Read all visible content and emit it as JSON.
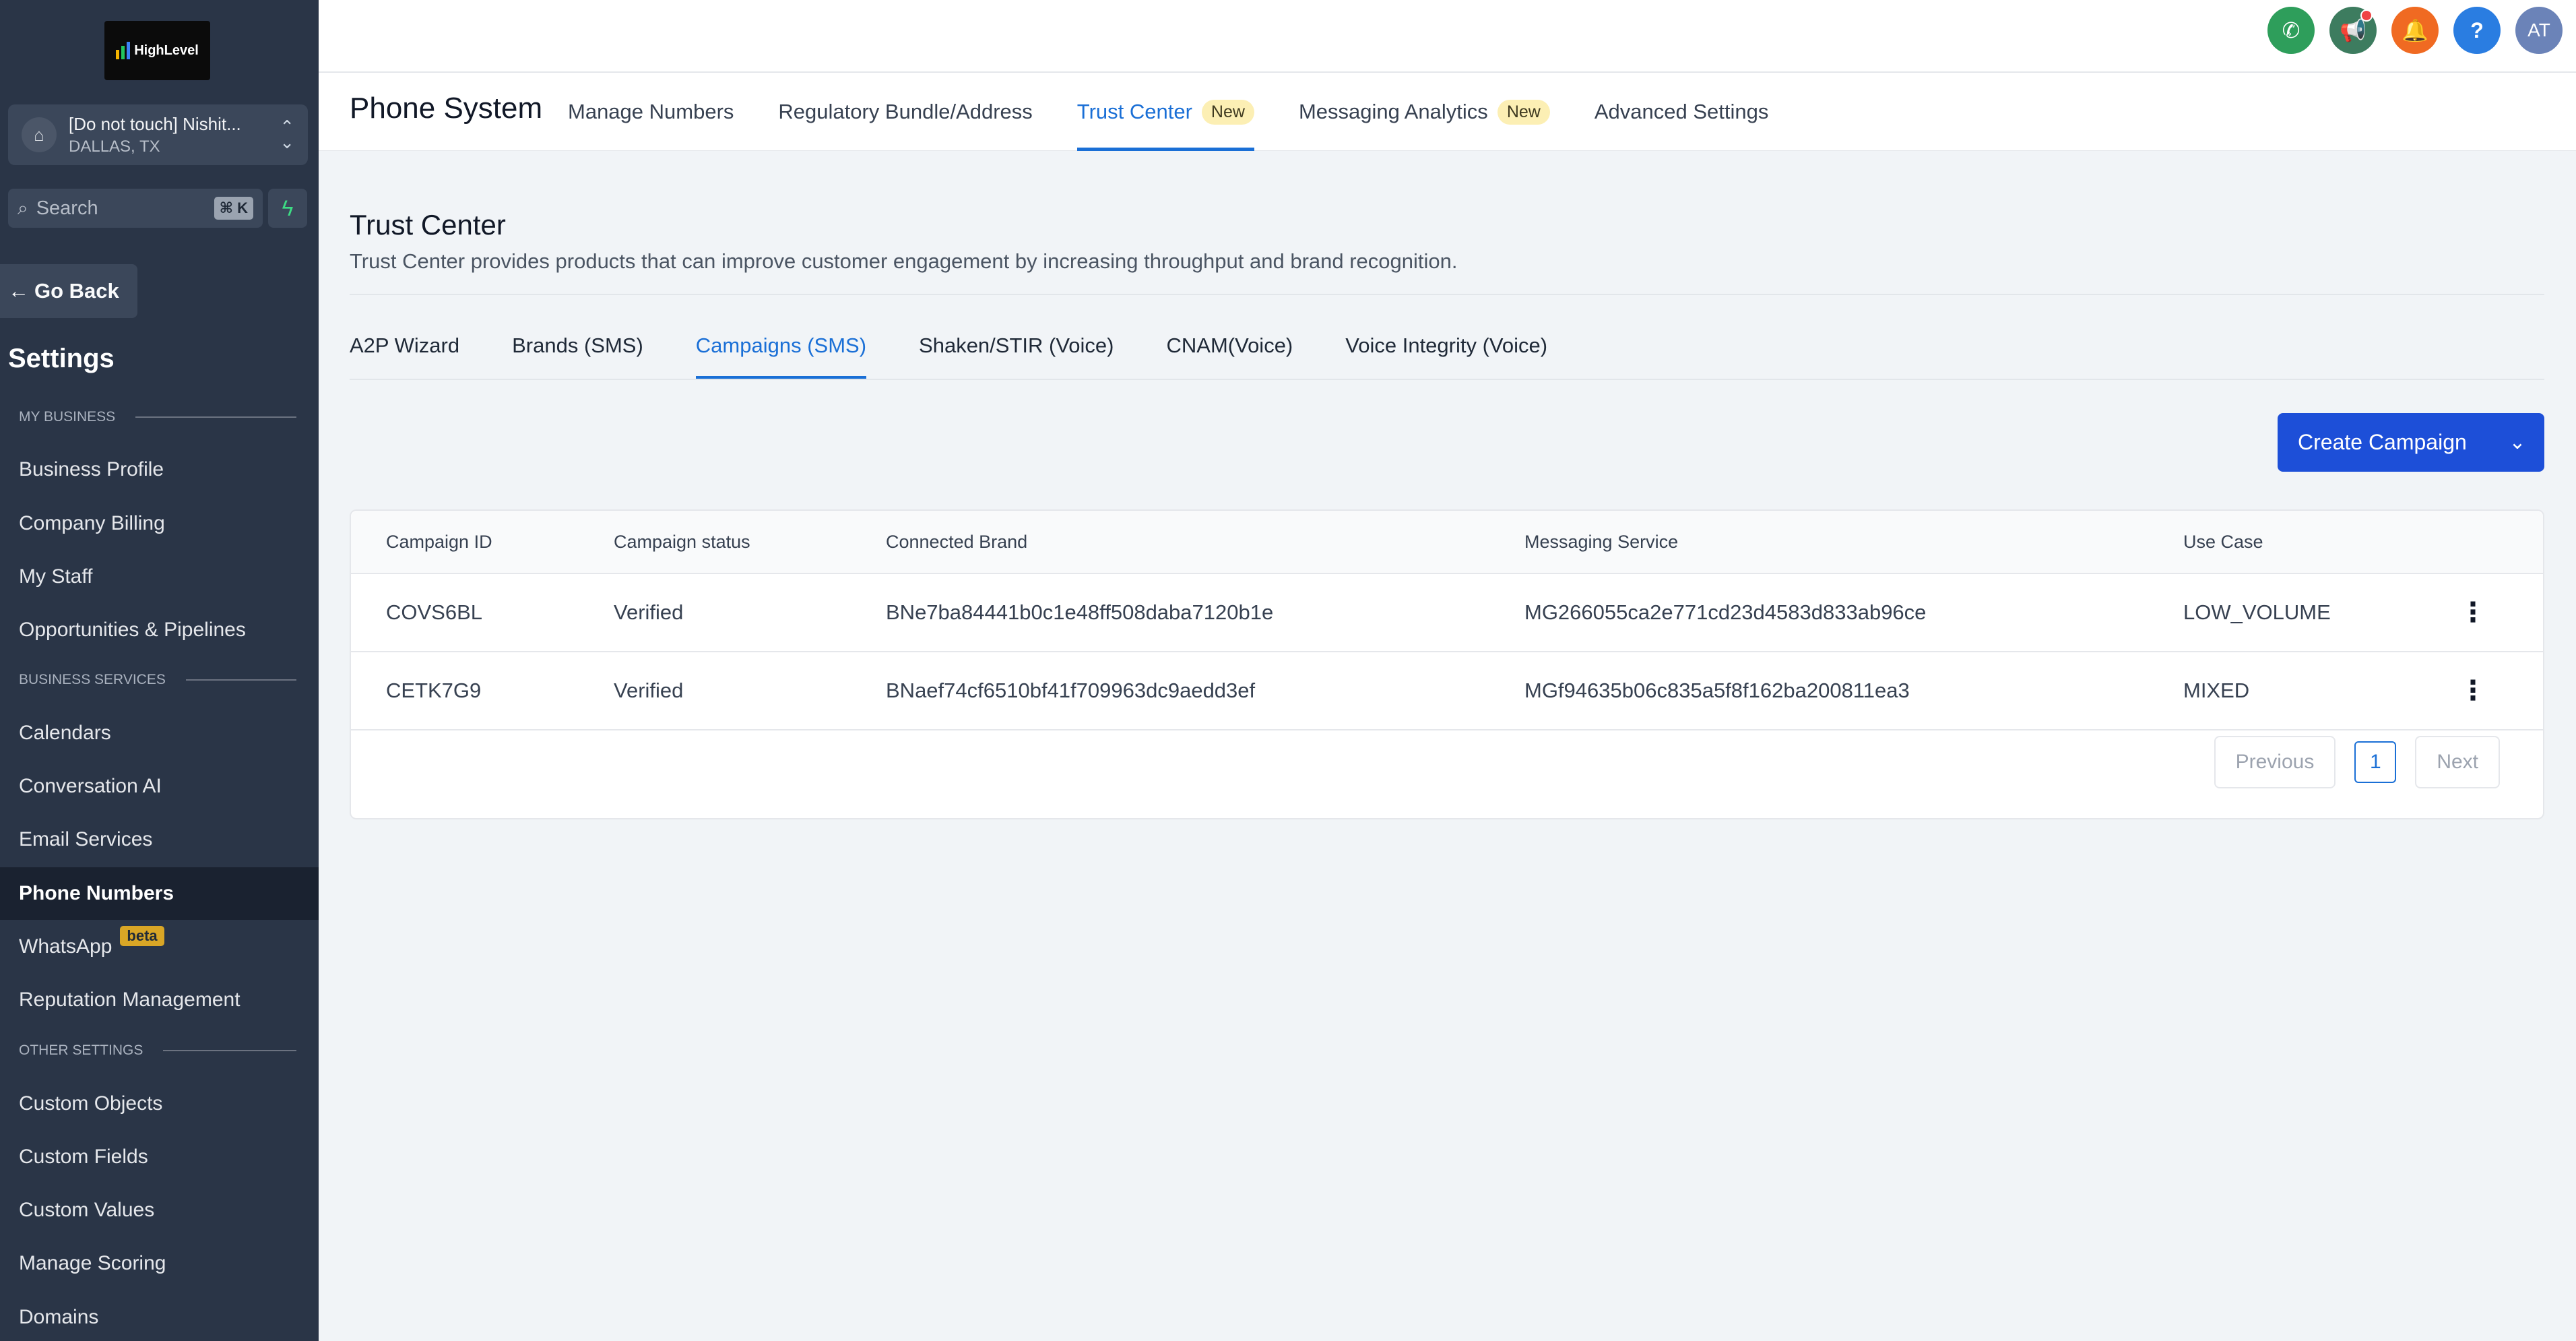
{
  "brand": {
    "logo_text": "HighLevel"
  },
  "account": {
    "name": "[Do not touch] Nishit...",
    "location": "DALLAS, TX"
  },
  "search": {
    "label": "Search",
    "shortcut": "⌘ K"
  },
  "sidebar": {
    "go_back": "Go Back",
    "title": "Settings",
    "sections": {
      "my_business": "MY BUSINESS",
      "business_services": "BUSINESS SERVICES",
      "other_settings": "OTHER SETTINGS"
    },
    "items": [
      "Business Profile",
      "Company Billing",
      "My Staff",
      "Opportunities & Pipelines",
      "Calendars",
      "Conversation AI",
      "Email Services",
      "Phone Numbers",
      "WhatsApp",
      "Reputation Management",
      "Custom Objects",
      "Custom Fields",
      "Custom Values",
      "Manage Scoring",
      "Domains"
    ],
    "beta_label": "beta",
    "active": "Phone Numbers"
  },
  "topbar": {
    "avatar_initials": "AT",
    "help_glyph": "?"
  },
  "header": {
    "title": "Phone System",
    "tabs": [
      {
        "label": "Manage Numbers"
      },
      {
        "label": "Regulatory Bundle/Address"
      },
      {
        "label": "Trust Center",
        "badge": "New"
      },
      {
        "label": "Messaging Analytics",
        "badge": "New"
      },
      {
        "label": "Advanced Settings"
      }
    ],
    "active_tab": "Trust Center"
  },
  "trust_center": {
    "title": "Trust Center",
    "description": "Trust Center provides products that can improve customer engagement by increasing throughput and brand recognition.",
    "tabs": [
      "A2P Wizard",
      "Brands (SMS)",
      "Campaigns (SMS)",
      "Shaken/STIR (Voice)",
      "CNAM(Voice)",
      "Voice Integrity (Voice)"
    ],
    "active_tab": "Campaigns (SMS)",
    "create_button": "Create Campaign"
  },
  "table": {
    "headers": [
      "Campaign ID",
      "Campaign status",
      "Connected Brand",
      "Messaging Service",
      "Use Case"
    ],
    "rows": [
      {
        "id": "COVS6BL",
        "status": "Verified",
        "brand": "BNe7ba84441b0c1e48ff508daba7120b1e",
        "service": "MG266055ca2e771cd23d4583d833ab96ce",
        "use_case": "LOW_VOLUME"
      },
      {
        "id": "CETK7G9",
        "status": "Verified",
        "brand": "BNaef74cf6510bf41f709963dc9aedd3ef",
        "service": "MGf94635b06c835a5f8f162ba200811ea3",
        "use_case": "MIXED"
      }
    ]
  },
  "pagination": {
    "previous": "Previous",
    "page": "1",
    "next": "Next"
  },
  "colors": {
    "sidebar_bg": "#2a3547",
    "accent": "#1a6fd6",
    "primary_button": "#1d4fd8",
    "badge_bg": "#fcefb4"
  }
}
